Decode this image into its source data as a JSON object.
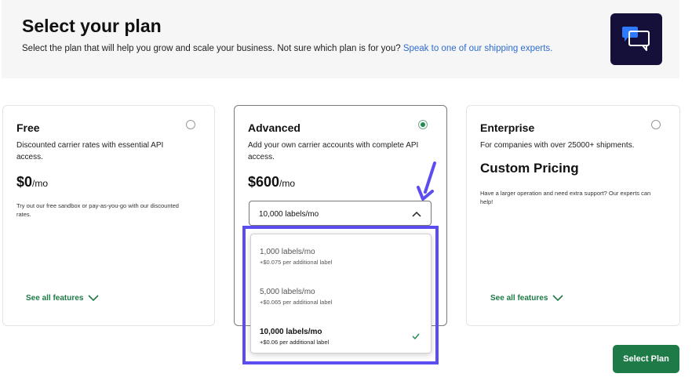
{
  "header": {
    "title": "Select your plan",
    "subtitle": "Select the plan that will help you grow and scale your business. Not sure which plan is for you?",
    "link": "Speak to one of our shipping experts.",
    "icon": "chat-bubbles-icon"
  },
  "plans": [
    {
      "name": "Free",
      "description": "Discounted carrier rates with essential API access.",
      "price": "$0",
      "per": "/mo",
      "note": "Try out our free sandbox or pay-as-you-go with our discounted rates.",
      "see_all": "See all features",
      "selected": false
    },
    {
      "name": "Advanced",
      "description": "Add your own carrier accounts with complete API access.",
      "price": "$600",
      "per": "/mo",
      "selected": true,
      "select_value": "10,000 labels/mo"
    },
    {
      "name": "Enterprise",
      "description": "For companies with over 25000+ shipments.",
      "custom_pricing": "Custom Pricing",
      "note": "Have a larger operation and need extra support? Our experts can help!",
      "see_all": "See all features",
      "selected": false
    }
  ],
  "dropdown_options": [
    {
      "label": "1,000 labels/mo",
      "sub": "+$0.075 per additional label",
      "selected": false
    },
    {
      "label": "5,000 labels/mo",
      "sub": "+$0.065 per additional label",
      "selected": false
    },
    {
      "label": "10,000 labels/mo",
      "sub": "+$0.06 per additional label",
      "selected": true
    }
  ],
  "select_plan_button": "Select Plan",
  "colors": {
    "accent": "#1e7a46",
    "link": "#2d6bcf",
    "highlight": "#5b4df0",
    "icon_bg": "#15103a"
  }
}
